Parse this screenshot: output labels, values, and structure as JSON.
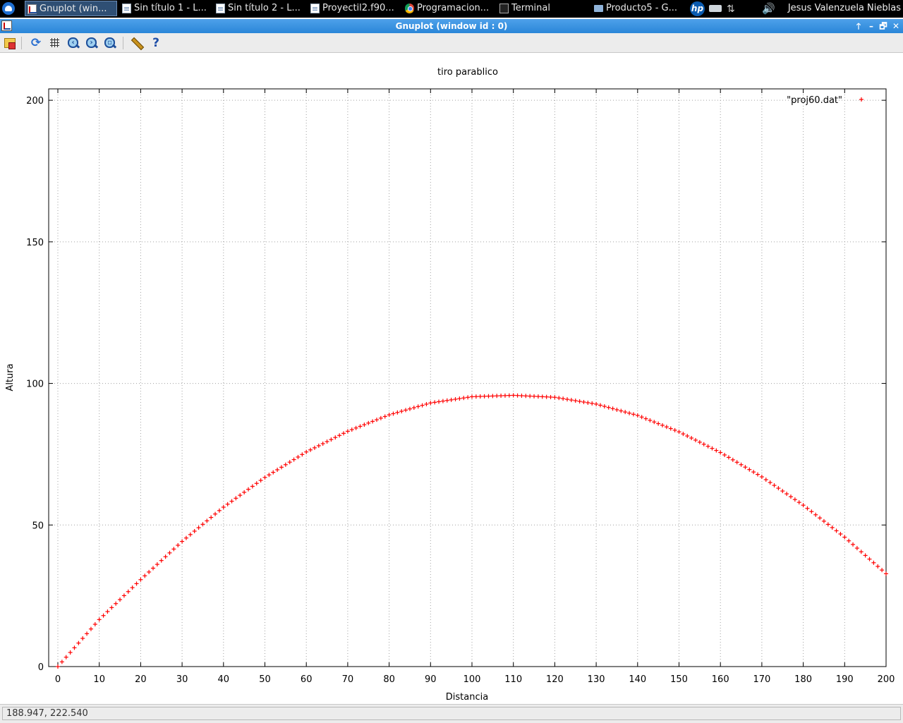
{
  "taskbar": {
    "tasks": [
      {
        "label": "Gnuplot (win...",
        "icon": "gnuplot-icon",
        "active": true
      },
      {
        "label": "Sin título 1 - L...",
        "icon": "document-icon"
      },
      {
        "label": "Sin título 2 - L...",
        "icon": "document-icon"
      },
      {
        "label": "Proyectil2.f90...",
        "icon": "document-icon"
      },
      {
        "label": "Programacion...",
        "icon": "chrome-icon"
      },
      {
        "label": "Terminal",
        "icon": "terminal-icon"
      },
      {
        "label": "Producto5 - G...",
        "icon": "folder-icon"
      }
    ],
    "hp_logo": "hp",
    "user": "Jesus Valenzuela Nieblas"
  },
  "window": {
    "title": "Gnuplot (window id : 0)",
    "buttons": {
      "raise": "🡑",
      "minimize": "–",
      "maximize": "🗗",
      "close": "✕"
    }
  },
  "toolbar": {
    "items": [
      "export-icon",
      "replot-icon",
      "grid-icon",
      "zoom-back-icon",
      "zoom-forward-icon",
      "zoom-fit-icon",
      "settings-icon",
      "help-icon"
    ],
    "replot_glyph": "⟳",
    "help_glyph": "?"
  },
  "chart_data": {
    "type": "scatter",
    "title": "tiro parablico",
    "xlabel": "Distancia",
    "ylabel": "Altura",
    "xlim": [
      0,
      200
    ],
    "ylim": [
      0,
      210
    ],
    "xticks": [
      0,
      10,
      20,
      30,
      40,
      50,
      60,
      70,
      80,
      90,
      100,
      110,
      120,
      130,
      140,
      150,
      160,
      170,
      180,
      190,
      200
    ],
    "yticks": [
      0,
      50,
      100,
      150,
      200
    ],
    "grid": true,
    "legend_position": "top-right",
    "point_marker": "+",
    "color": "#ff0000",
    "series": [
      {
        "name": "\"proj60.dat\"",
        "x": [
          0,
          10,
          20,
          30,
          40,
          50,
          60,
          70,
          80,
          90,
          100,
          110,
          120,
          130,
          140,
          150,
          160,
          170,
          180,
          190,
          200
        ],
        "y": [
          0,
          16.6,
          30.7,
          44.2,
          56.3,
          66.8,
          75.8,
          83.1,
          88.9,
          93.1,
          95.3,
          95.8,
          95.1,
          92.7,
          88.7,
          82.9,
          75.6,
          67.0,
          57.0,
          45.7,
          32.8
        ]
      }
    ]
  },
  "statusbar": {
    "coords": "188.947,  222.540"
  }
}
